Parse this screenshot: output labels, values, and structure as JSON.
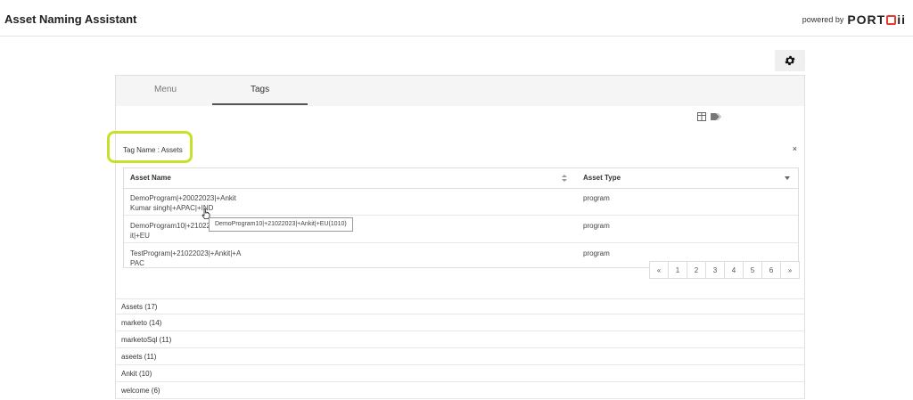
{
  "header": {
    "title": "Asset Naming Assistant",
    "powered_by": "powered by",
    "brand_prefix": "PORT",
    "brand_suffix": "ii"
  },
  "tabs": [
    {
      "label": "Menu"
    },
    {
      "label": "Tags"
    }
  ],
  "tag_panel": {
    "tag_name_label": "Tag Name : Assets",
    "close_symbol": "×"
  },
  "table": {
    "columns": [
      "Asset Name",
      "Asset Type"
    ],
    "rows": [
      {
        "name_line1": "DemoProgram|+20022023|+Ankit",
        "name_line2": "Kumar singh|+APAC|+IND",
        "type": "program"
      },
      {
        "name_line1": "DemoProgram10|+21022023|+Ank",
        "name_line2": "it|+EU",
        "type": "program"
      },
      {
        "name_line1": "TestProgram|+21022023|+Ankit|+A",
        "name_line2": "PAC",
        "type": "program"
      }
    ]
  },
  "tooltip": "DemoProgram10|+21022023|+Ankit|+EU(1010)",
  "pagination": [
    "«",
    "1",
    "2",
    "3",
    "4",
    "5",
    "6",
    "»"
  ],
  "tag_list": [
    "Assets (17)",
    "marketo (14)",
    "marketoSql (11)",
    "aseets (11)",
    "Ankit (10)",
    "welcome (6)"
  ],
  "colors": {
    "highlight": "#c8e02a",
    "brand_accent": "#e8392f"
  }
}
